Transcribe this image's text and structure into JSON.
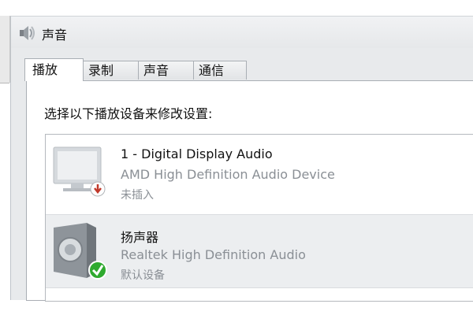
{
  "window": {
    "title": "声音",
    "icon": "speaker-icon"
  },
  "tabs": [
    {
      "label": "播放",
      "active": true
    },
    {
      "label": "录制",
      "active": false
    },
    {
      "label": "声音",
      "active": false
    },
    {
      "label": "通信",
      "active": false
    }
  ],
  "playback": {
    "prompt": "选择以下播放设备来修改设置:",
    "devices": [
      {
        "name": "1 - Digital Display Audio",
        "description": "AMD High Definition Audio Device",
        "status": "未插入",
        "icon": "monitor-icon",
        "badge": "unplugged-arrow-icon",
        "selected": false
      },
      {
        "name": "扬声器",
        "description": "Realtek High Definition Audio",
        "status": "默认设备",
        "icon": "speaker-device-icon",
        "badge": "default-check-icon",
        "selected": true
      }
    ]
  },
  "colors": {
    "dialog_bg": "#e8eaec",
    "selected_row": "#eceef0",
    "secondary_text": "#8a8f95",
    "check_green": "#2faa2f",
    "unplugged_red": "#c0392b"
  }
}
